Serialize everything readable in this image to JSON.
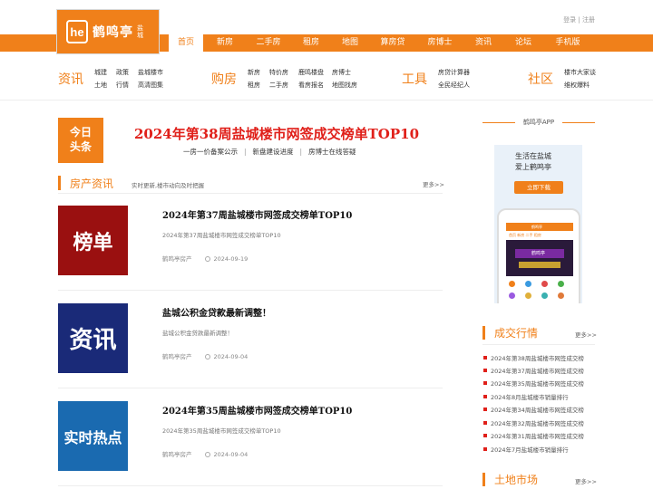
{
  "logo": {
    "badge": "he",
    "name": "鹤鸣亭",
    "sub": "盐城"
  },
  "toplinks": {
    "login": "登录",
    "sep": "|",
    "register": "注册"
  },
  "nav": [
    "首页",
    "新房",
    "二手房",
    "租房",
    "地图",
    "算房贷",
    "房博士",
    "资讯",
    "论坛",
    "手机版"
  ],
  "subnav": [
    {
      "title": "资讯",
      "row1": [
        "城建",
        "政策",
        "盐城楼市"
      ],
      "row2": [
        "土地",
        "行情",
        "高清图集"
      ]
    },
    {
      "title": "购房",
      "row1": [
        "新房",
        "特价房",
        "鹿鸣楼盘",
        "房博士"
      ],
      "row2": [
        "租房",
        "二手房",
        "看房报名",
        "地图找房"
      ]
    },
    {
      "title": "工具",
      "row1": [
        "房贷计算器"
      ],
      "row2": [
        "全民经纪人"
      ]
    },
    {
      "title": "社区",
      "row1": [
        "楼市大家谈"
      ],
      "row2": [
        "维权爆料"
      ]
    }
  ],
  "today": {
    "line1": "今日",
    "line2": "头条"
  },
  "headline": "2024年第38周盐城楼市网签成交榜单TOP10",
  "headsub": [
    "一房一价备案公示",
    "新盘建设进度",
    "房博士在线答疑"
  ],
  "headsub_sep": "|",
  "news_section": {
    "title": "房产资讯",
    "desc": "实时更新,楼市动向及时把握",
    "more": "更多>>"
  },
  "news": [
    {
      "img_text": "榜单",
      "title": "2024年第37周盐城楼市网签成交榜单TOP10",
      "summary": "2024年第37周盐城楼市网签成交榜单TOP10",
      "source": "鹤鸣亭房产",
      "date": "2024-09-19"
    },
    {
      "img_text": "资讯",
      "title": "盐城公积金贷款最新调整！",
      "summary": "盐城公积金贷款最新调整！",
      "source": "鹤鸣亭房产",
      "date": "2024-09-04"
    },
    {
      "img_text": "实时热点",
      "title": "2024年第35周盐城楼市网签成交榜单TOP10",
      "summary": "2024年第35周盐城楼市网签成交榜单TOP10",
      "source": "鹤鸣亭房产",
      "date": "2024-09-04"
    }
  ],
  "colors": {
    "accent": "#f0801a",
    "headline": "#e0201a",
    "img1": "#9a1010",
    "img2": "#1a2a78",
    "img3": "#1a6ab0"
  },
  "app": {
    "head": "鹤鸣亭APP",
    "slogan1": "生活在盐城",
    "slogan2": "爱上鹤鸣亭",
    "button": "立即下载",
    "phone_title": "鹤鸣亭",
    "phone_tabs": "首页 新房 二手 租房",
    "phone_banner": "鹤鸣亭"
  },
  "deals": {
    "title": "成交行情",
    "more": "更多>>",
    "items": [
      "2024年第38周盐城楼市网签成交榜",
      "2024年第37周盐城楼市网签成交榜",
      "2024年第35周盐城楼市网签成交榜",
      "2024年8月盐城楼市销量排行",
      "2024年第34周盐城楼市网签成交榜",
      "2024年第32周盐城楼市网签成交榜",
      "2024年第31周盐城楼市网签成交榜",
      "2024年7月盐城楼市销量排行"
    ]
  },
  "land": {
    "title": "土地市场",
    "more": "更多>>"
  }
}
